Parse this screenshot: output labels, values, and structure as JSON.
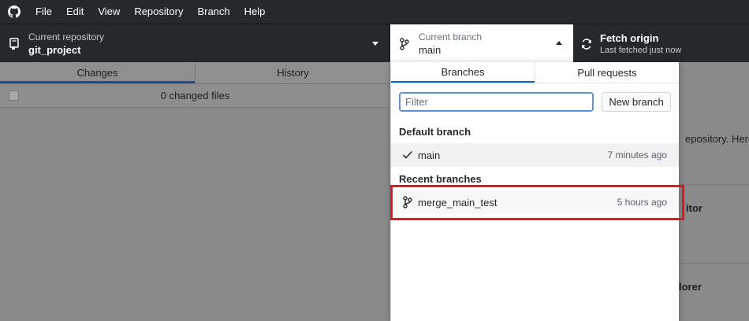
{
  "menubar": {
    "items": [
      "File",
      "Edit",
      "View",
      "Repository",
      "Branch",
      "Help"
    ]
  },
  "toolbar": {
    "repo": {
      "label": "Current repository",
      "value": "git_project"
    },
    "branch": {
      "label": "Current branch",
      "value": "main"
    },
    "fetch": {
      "label": "Fetch origin",
      "sub": "Last fetched just now"
    }
  },
  "left_pane": {
    "tabs": [
      "Changes",
      "History"
    ],
    "changes_text": "0 changed files"
  },
  "right_pane": {
    "fragments": [
      "epository. Here a",
      "itor",
      "lorer"
    ]
  },
  "popover": {
    "tabs": [
      "Branches",
      "Pull requests"
    ],
    "filter_placeholder": "Filter",
    "new_branch_label": "New branch",
    "default_heading": "Default branch",
    "recent_heading": "Recent branches",
    "default_branch": {
      "name": "main",
      "time": "7 minutes ago"
    },
    "recent_branches": [
      {
        "name": "merge_main_test",
        "time": "5 hours ago"
      }
    ]
  },
  "colors": {
    "toolbar_bg": "#24292e",
    "accent_blue": "#0366d6",
    "highlight_red": "#e0191f"
  }
}
